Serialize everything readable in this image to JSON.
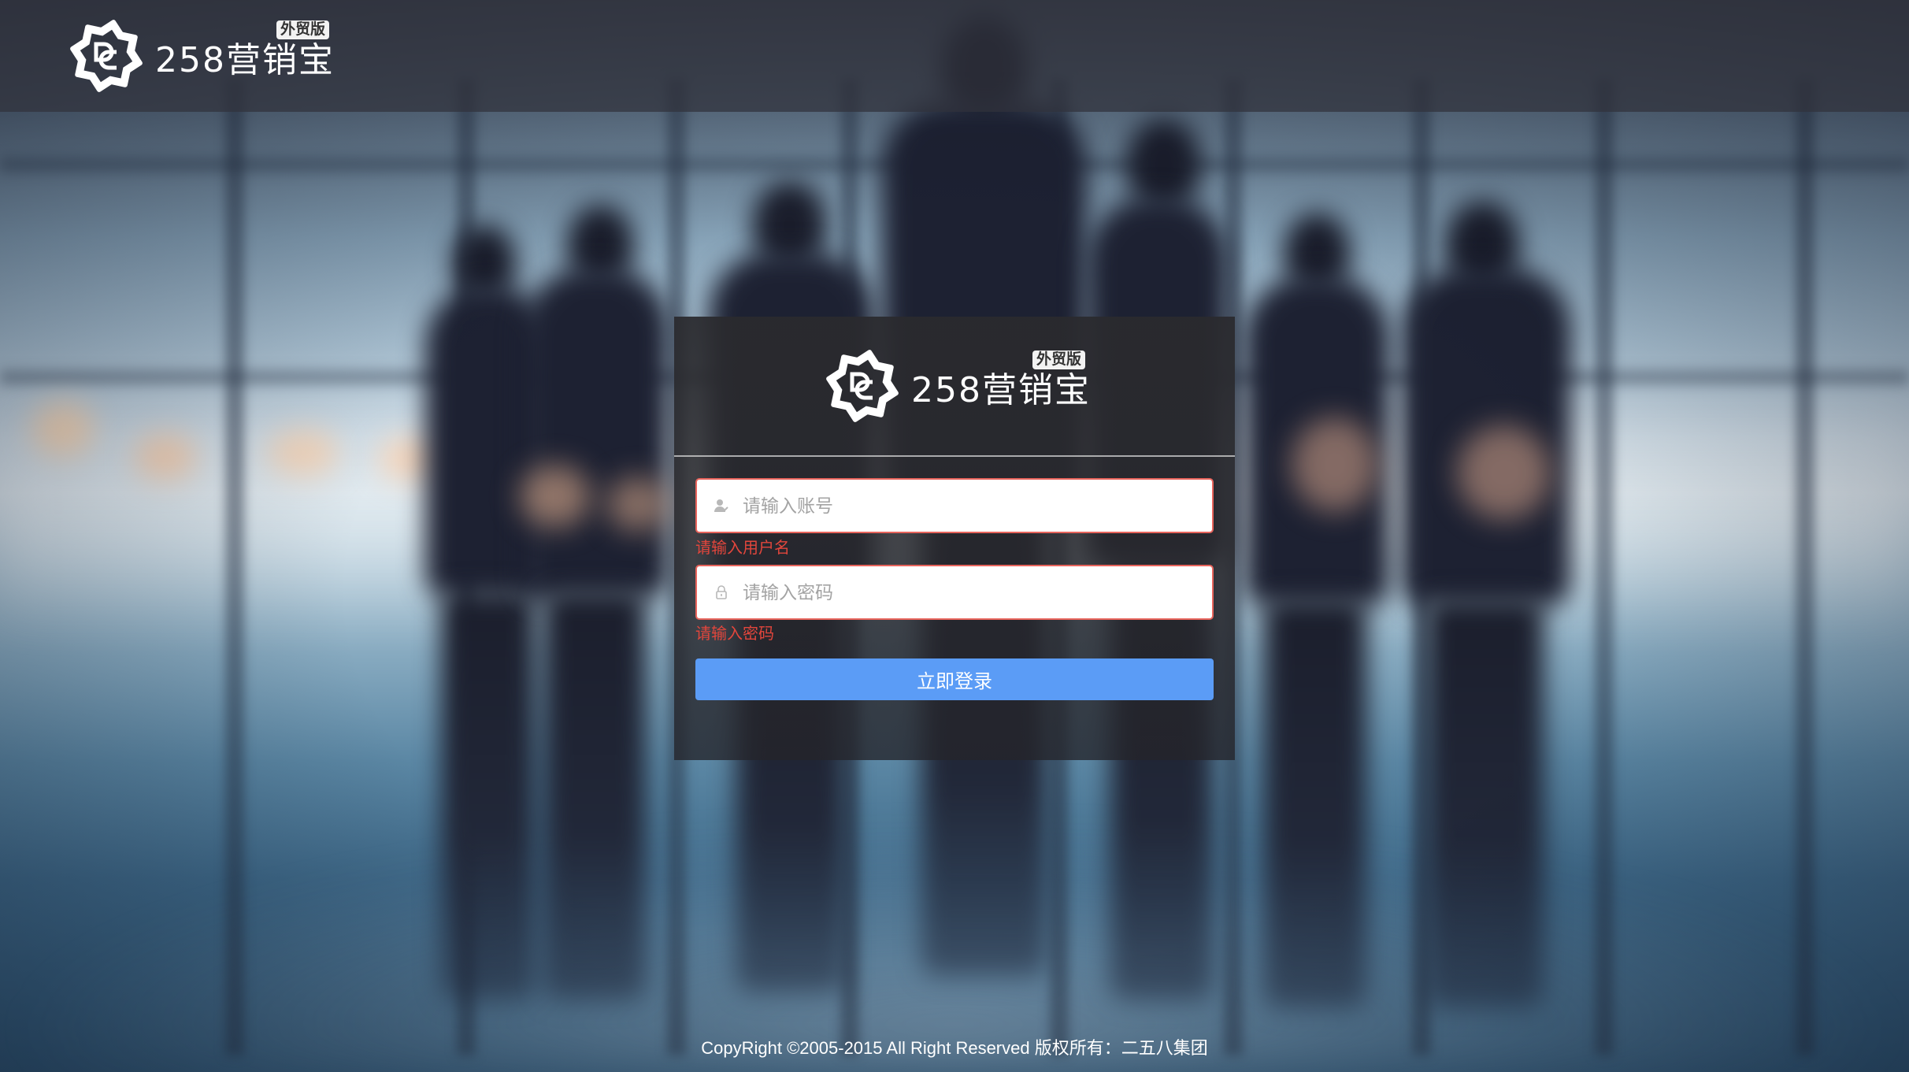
{
  "logo": {
    "name": "258营销宝",
    "badge": "外贸版",
    "emblem_icon": "logo-emblem-icon"
  },
  "login": {
    "username": {
      "icon": "user-icon",
      "value": "",
      "placeholder": "请输入账号",
      "error": "请输入用户名"
    },
    "password": {
      "icon": "lock-icon",
      "value": "",
      "placeholder": "请输入密码",
      "error": "请输入密码"
    },
    "submit_label": "立即登录"
  },
  "footer": {
    "copyright": "CopyRight ©2005-2015 All Right Reserved 版权所有：二五八集团"
  },
  "colors": {
    "accent": "#5b9cf6",
    "error_text": "#e2463c",
    "error_border": "#e8645c",
    "header_bg": "#30323c",
    "panel_bg": "#2a2a2e"
  }
}
